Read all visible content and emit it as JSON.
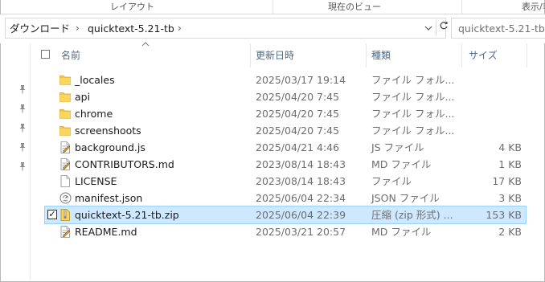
{
  "ribbon": {
    "groups": [
      "レイアウト",
      "現在のビュー",
      "表示/非"
    ]
  },
  "address_bar": {
    "path": [
      "ダウンロード",
      "quicktext-5.21-tb"
    ],
    "dropdown_icon": "chevron-down-icon",
    "refresh_icon": "refresh-icon"
  },
  "search": {
    "value": "quicktext-5.21-tb"
  },
  "nav": {
    "pin_icon": "pin-icon",
    "pin_count": 5
  },
  "columns": {
    "name": "名前",
    "date": "更新日時",
    "type": "種類",
    "size": "サイズ"
  },
  "files": [
    {
      "name": "_locales",
      "date": "2025/03/17 19:14",
      "type": "ファイル フォル...",
      "size": "",
      "icon": "folder-icon",
      "selected": false
    },
    {
      "name": "api",
      "date": "2025/04/20 7:45",
      "type": "ファイル フォル...",
      "size": "",
      "icon": "folder-icon",
      "selected": false
    },
    {
      "name": "chrome",
      "date": "2025/04/20 7:45",
      "type": "ファイル フォル...",
      "size": "",
      "icon": "folder-icon",
      "selected": false
    },
    {
      "name": "screenshoots",
      "date": "2025/04/20 7:45",
      "type": "ファイル フォル...",
      "size": "",
      "icon": "folder-icon",
      "selected": false
    },
    {
      "name": "background.js",
      "date": "2025/04/21 4:46",
      "type": "JS ファイル",
      "size": "4 KB",
      "icon": "script-file-icon",
      "selected": false
    },
    {
      "name": "CONTRIBUTORS.md",
      "date": "2023/08/14 18:43",
      "type": "MD ファイル",
      "size": "1 KB",
      "icon": "text-file-icon",
      "selected": false
    },
    {
      "name": "LICENSE",
      "date": "2023/08/14 18:43",
      "type": "ファイル",
      "size": "17 KB",
      "icon": "blank-file-icon",
      "selected": false
    },
    {
      "name": "manifest.json",
      "date": "2025/06/04 22:34",
      "type": "JSON ファイル",
      "size": "3 KB",
      "icon": "json-file-icon",
      "selected": false
    },
    {
      "name": "quicktext-5.21-tb.zip",
      "date": "2025/06/04 22:39",
      "type": "圧縮 (zip 形式) ...",
      "size": "153 KB",
      "icon": "zip-file-icon",
      "selected": true
    },
    {
      "name": "README.md",
      "date": "2025/03/21 20:57",
      "type": "MD ファイル",
      "size": "2 KB",
      "icon": "text-file-icon",
      "selected": false
    }
  ],
  "colors": {
    "selected_row": "#cde8ff",
    "selected_border": "#99d1ff",
    "folder": "#f5c44b",
    "header_text": "#4c6a8c"
  }
}
